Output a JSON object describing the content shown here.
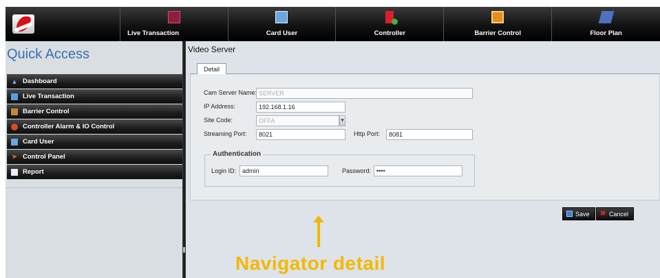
{
  "topnav": {
    "items": [
      {
        "label": "Live Transaction",
        "icon": "live-transaction-icon"
      },
      {
        "label": "Card User",
        "icon": "card-user-icon"
      },
      {
        "label": "Controller",
        "icon": "controller-icon"
      },
      {
        "label": "Barrier Control",
        "icon": "barrier-control-icon"
      },
      {
        "label": "Floor Plan",
        "icon": "floor-plan-icon"
      }
    ]
  },
  "sidebar": {
    "title": "Quick Access",
    "items": [
      {
        "label": "Dashboard",
        "icon": "home-icon"
      },
      {
        "label": "Live Transaction",
        "icon": "monitor-icon"
      },
      {
        "label": "Barrier Control",
        "icon": "barrier-icon"
      },
      {
        "label": "Controller Alarm & IO Control",
        "icon": "alarm-icon"
      },
      {
        "label": "Card User",
        "icon": "card-user-icon"
      },
      {
        "label": "Control Panel",
        "icon": "control-panel-icon"
      },
      {
        "label": "Report",
        "icon": "report-icon"
      }
    ]
  },
  "main": {
    "title": "Video Server",
    "tab": "Detail",
    "form": {
      "cam_server_name": {
        "label": "Cam Server Name:",
        "value": "SERVER"
      },
      "ip_address": {
        "label": "IP Address:",
        "value": "192.168.1.16"
      },
      "site_code": {
        "label": "Site Code:",
        "value": "OFFA"
      },
      "streaming_port": {
        "label": "Streaming Port:",
        "value": "8021"
      },
      "http_port": {
        "label": "Http Port:",
        "value": "8081"
      }
    },
    "authentication": {
      "legend": "Authentication",
      "login_id": {
        "label": "Login ID:",
        "value": "admin"
      },
      "password": {
        "label": "Password:",
        "value": "••••"
      }
    },
    "buttons": {
      "save": "Save",
      "cancel": "Cancel"
    }
  },
  "annotation": {
    "text": "Navigator detail",
    "color": "#f5b800"
  }
}
